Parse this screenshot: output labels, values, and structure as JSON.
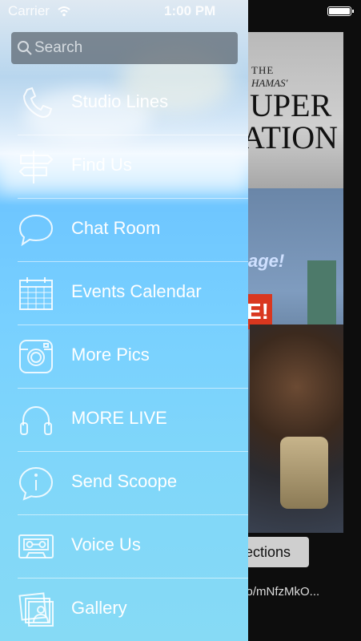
{
  "status_bar": {
    "carrier": "Carrier",
    "time": "1:00 PM"
  },
  "search": {
    "placeholder": "Search",
    "icon": "search-icon"
  },
  "menu": {
    "items": [
      {
        "label": "Studio Lines",
        "icon": "phone-icon"
      },
      {
        "label": "Find Us",
        "icon": "signpost-icon"
      },
      {
        "label": "Chat Room",
        "icon": "chat-bubble-icon"
      },
      {
        "label": "Events Calendar",
        "icon": "calendar-icon"
      },
      {
        "label": "More Pics",
        "icon": "camera-icon"
      },
      {
        "label": "MORE LIVE",
        "icon": "headphones-icon"
      },
      {
        "label": "Send Scoope",
        "icon": "info-icon"
      },
      {
        "label": "Voice Us",
        "icon": "cassette-icon"
      },
      {
        "label": "Gallery",
        "icon": "photo-stack-icon"
      }
    ]
  },
  "background": {
    "header_line1": "THE",
    "header_line2": "HAMAS'",
    "header_line3": "UPER",
    "header_line4": "ATION",
    "tagline": "age!",
    "sign": "E!",
    "directions_button": "ections",
    "link_text": "co/mNfzMkO..."
  },
  "colors": {
    "drawer_top": "#dfe9f2",
    "drawer_bottom": "#86daf5",
    "search_bg": "#5a646e",
    "text": "#ffffff"
  }
}
